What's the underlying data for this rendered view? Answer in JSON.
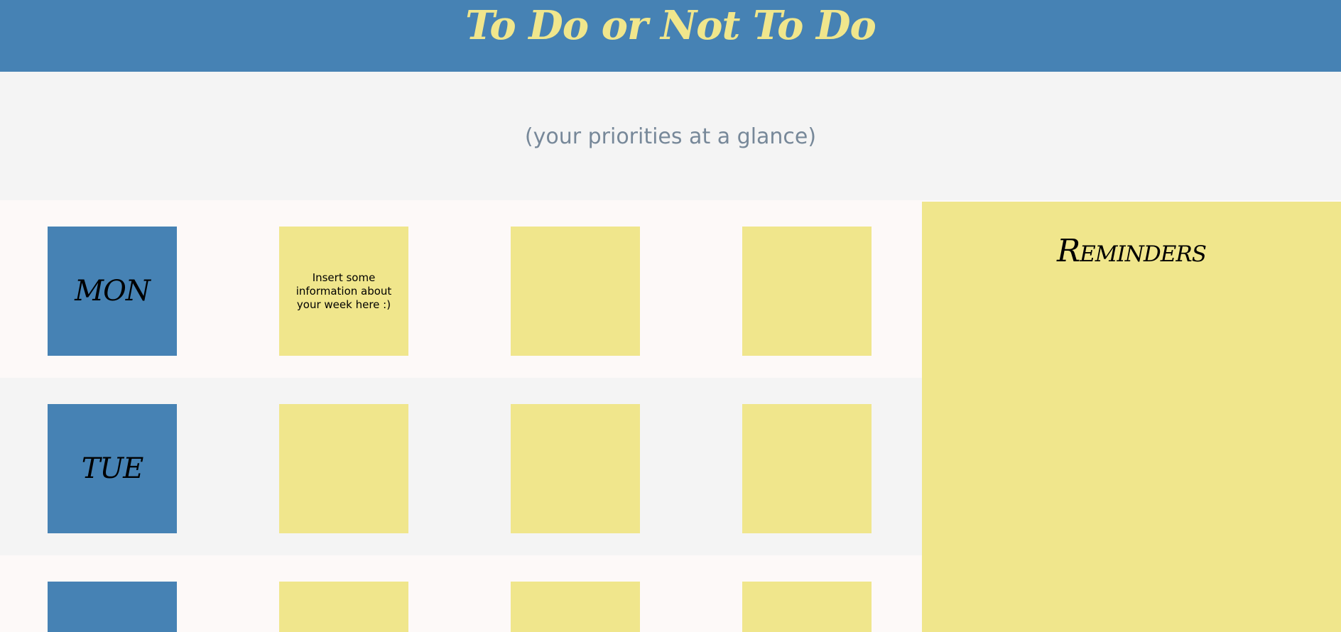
{
  "header": {
    "title": "To Do or Not To Do",
    "subtitle": "(your priorities at a glance)"
  },
  "days": [
    {
      "label": "MON",
      "notes": [
        "Insert some information about your week here :)",
        "",
        ""
      ]
    },
    {
      "label": "TUE",
      "notes": [
        "",
        "",
        ""
      ]
    },
    {
      "label": "",
      "notes": [
        "",
        "",
        ""
      ]
    }
  ],
  "reminders": {
    "title": "Reminders"
  },
  "colors": {
    "accent_blue": "#4682b4",
    "note_yellow": "#f0e68c",
    "subtitle_gray": "#778899",
    "band_gray": "#f4f4f4",
    "band_light": "#fdf9f8"
  }
}
